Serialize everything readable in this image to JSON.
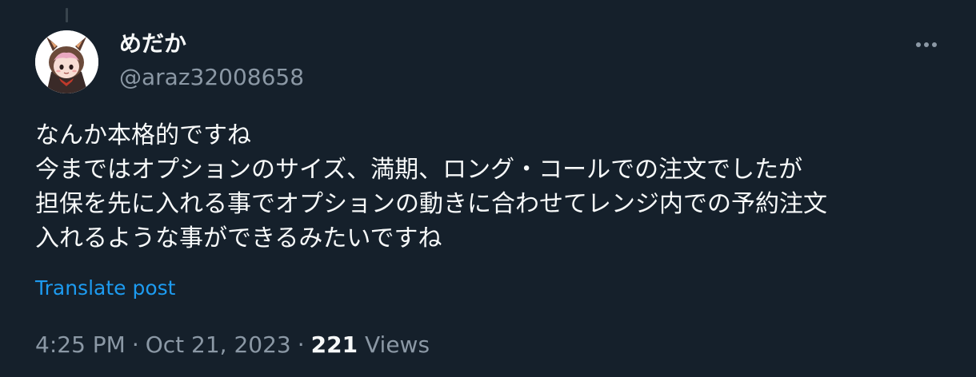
{
  "tweet": {
    "author": {
      "display_name": "めだか",
      "handle": "@araz32008658",
      "avatar_icon": "anime-avatar-icon"
    },
    "more_icon": "more-dots-icon",
    "text_lines": [
      "なんか本格的ですね",
      "今まではオプションのサイズ、満期、ロング・コールでの注文でしたが",
      "担保を先に入れる事でオプションの動きに合わせてレンジ内での予約注文",
      "入れるような事ができるみたいですね"
    ],
    "translate_label": "Translate post",
    "time": "4:25 PM",
    "separator": "·",
    "date": "Oct 21, 2023",
    "views_count": "221",
    "views_label": "Views"
  },
  "colors": {
    "background": "#15202b",
    "primary_text": "#f7f9f9",
    "secondary_text": "#8b98a5",
    "link": "#1d9bf0"
  }
}
